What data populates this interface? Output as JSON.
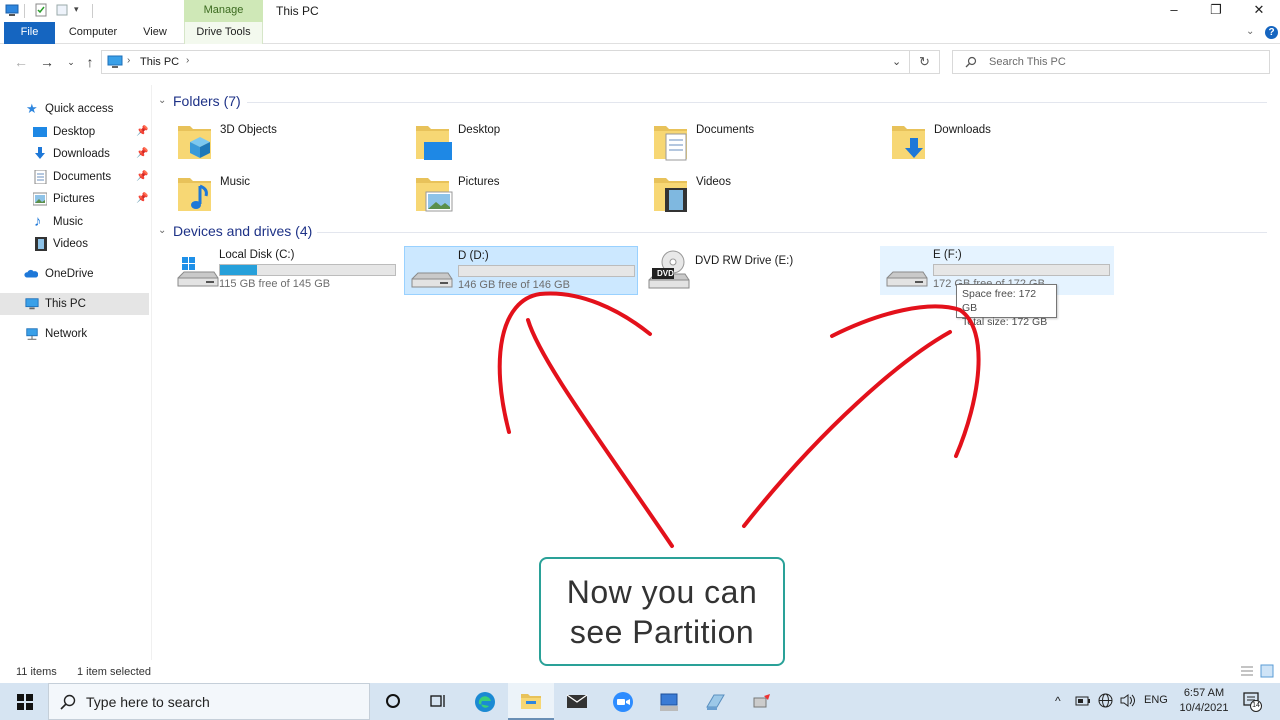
{
  "window": {
    "title": "This PC",
    "context_tab": "Manage",
    "minimize": "–",
    "maximize": "❐",
    "close": "✕"
  },
  "ribbon": {
    "tabs": [
      "File",
      "Computer",
      "View",
      "Drive Tools"
    ]
  },
  "address": {
    "path": "This PC",
    "search_placeholder": "Search This PC"
  },
  "sidebar": {
    "quick_access": "Quick access",
    "items": [
      {
        "label": "Desktop",
        "pinned": true
      },
      {
        "label": "Downloads",
        "pinned": true
      },
      {
        "label": "Documents",
        "pinned": true
      },
      {
        "label": "Pictures",
        "pinned": true
      },
      {
        "label": "Music",
        "pinned": false
      },
      {
        "label": "Videos",
        "pinned": false
      }
    ],
    "onedrive": "OneDrive",
    "this_pc": "This PC",
    "network": "Network"
  },
  "folders": {
    "header": "Folders (7)",
    "items": [
      "3D Objects",
      "Desktop",
      "Documents",
      "Downloads",
      "Music",
      "Pictures",
      "Videos"
    ]
  },
  "drives": {
    "header": "Devices and drives (4)",
    "items": [
      {
        "name": "Local Disk (C:)",
        "free": "115 GB free of 145 GB",
        "used_fraction": 0.21,
        "state": "normal"
      },
      {
        "name": "D (D:)",
        "free": "146 GB free of 146 GB",
        "used_fraction": 0.0,
        "state": "selected"
      },
      {
        "name": "DVD RW Drive (E:)",
        "free": "",
        "used_fraction": null,
        "state": "normal"
      },
      {
        "name": "E (F:)",
        "free": "172 GB free of 172 GB",
        "used_fraction": 0.0,
        "state": "hover"
      }
    ],
    "dvd_label": "DVD"
  },
  "tooltip": {
    "line1": "Space free: 172 GB",
    "line2": "Total size: 172 GB"
  },
  "status": {
    "count": "11 items",
    "selected": "1 item selected"
  },
  "annotation": {
    "line1": "Now you can",
    "line2": "see Partition",
    "arrow_color": "#e3111b",
    "box_border": "#2aa198"
  },
  "taskbar": {
    "search_placeholder": "Type here to search",
    "lang": "ENG",
    "time": "6:57 AM",
    "date": "10/4/2021",
    "notifications": "14"
  },
  "colors": {
    "accent": "#1565c0",
    "selection": "#cce8ff",
    "bar_fill": "#26a0da",
    "context_tab": "#cfe8b7"
  }
}
